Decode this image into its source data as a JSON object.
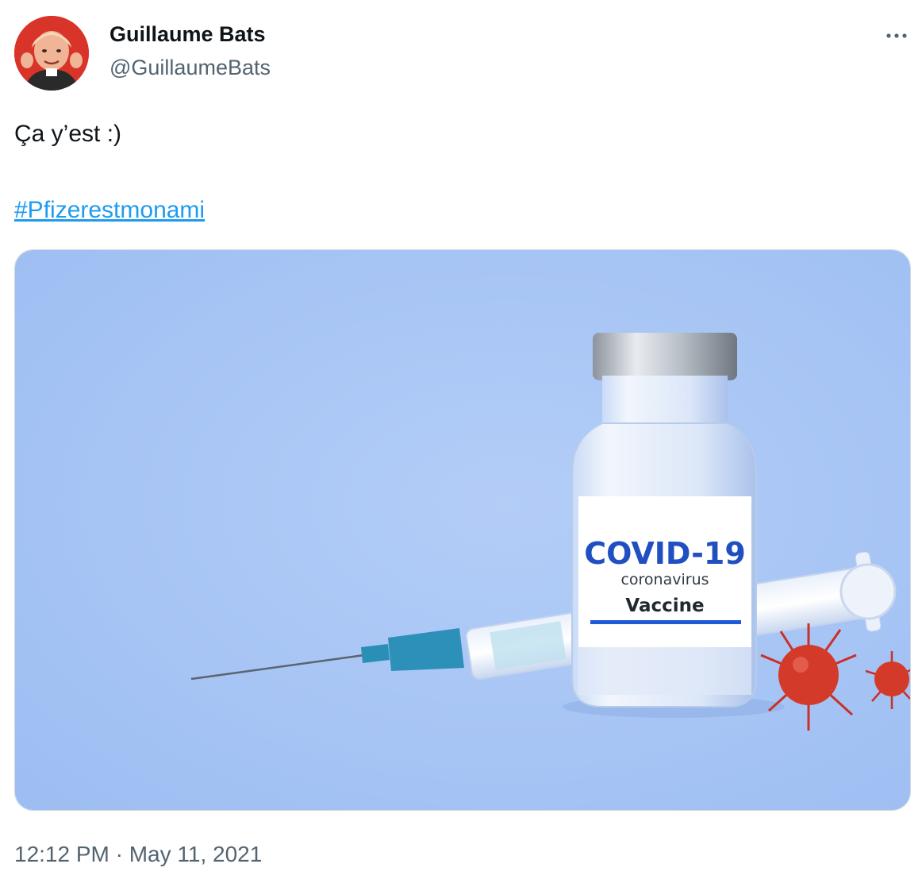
{
  "author": {
    "display_name": "Guillaume Bats",
    "handle": "@GuillaumeBats",
    "avatar_icon": "avatar-photo"
  },
  "tweet": {
    "text": "Ça y’est :)",
    "hashtag": "#Pfizerestmonami",
    "timestamp": "12:12 PM · May 11, 2021"
  },
  "media": {
    "vial_label_title": "COVID-19",
    "vial_label_subtitle": "coronavirus",
    "vial_label_product": "Vaccine"
  },
  "icons": {
    "more": "more-horizontal-icon"
  },
  "colors": {
    "link": "#1d9bf0",
    "secondary_text": "#536471",
    "primary_text": "#0f1419",
    "media_background": "#a9c6f5",
    "label_blue": "#1f4fc1",
    "virus_red": "#d33a2a"
  }
}
